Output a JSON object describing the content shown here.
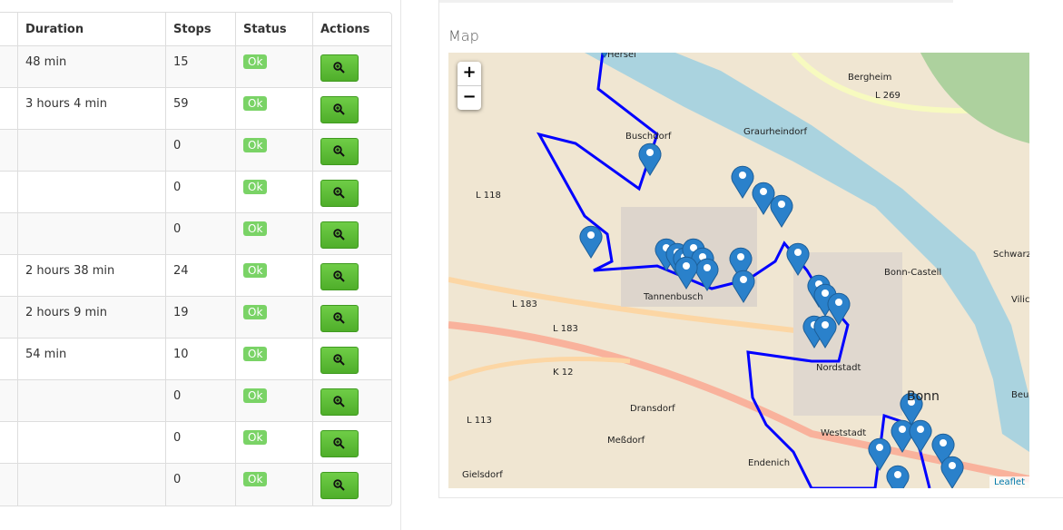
{
  "table": {
    "headers": [
      "",
      "Duration",
      "Stops",
      "Status",
      "Actions"
    ],
    "rows": [
      {
        "duration": "48 min",
        "stops": "15",
        "status": "Ok"
      },
      {
        "duration": "3 hours 4 min",
        "stops": "59",
        "status": "Ok"
      },
      {
        "duration": "",
        "stops": "0",
        "status": "Ok"
      },
      {
        "duration": "",
        "stops": "0",
        "status": "Ok"
      },
      {
        "duration": "",
        "stops": "0",
        "status": "Ok"
      },
      {
        "duration": "2 hours 38 min",
        "stops": "24",
        "status": "Ok"
      },
      {
        "duration": "2 hours 9 min",
        "stops": "19",
        "status": "Ok"
      },
      {
        "duration": "54 min",
        "stops": "10",
        "status": "Ok"
      },
      {
        "duration": "",
        "stops": "0",
        "status": "Ok"
      },
      {
        "duration": "",
        "stops": "0",
        "status": "Ok"
      },
      {
        "duration": "",
        "stops": "0",
        "status": "Ok"
      }
    ],
    "action_icon": "zoom-in-icon",
    "colors": {
      "ok": "#7ad366",
      "button": "#5cbd35"
    }
  },
  "map": {
    "title": "Map",
    "zoom_in": "+",
    "zoom_out": "−",
    "attribution": "Leaflet",
    "route_color": "#0000ff",
    "marker_color": "#2a81cb",
    "places": [
      "Bergheim",
      "Hersel",
      "L 269",
      "Buschdorf",
      "Graurheindorf",
      "L 118",
      "Schwarzrheindorf",
      "Bonn-Castell",
      "Vilich-Rheindorf",
      "Tannenbusch",
      "L 183",
      "L 183",
      "Dransdorf",
      "K 12",
      "Nordstadt",
      "Bonn",
      "Beuel-Mitte",
      "L 113",
      "Weststadt",
      "Meßdorf",
      "Endenich",
      "Gielsdorf"
    ]
  }
}
